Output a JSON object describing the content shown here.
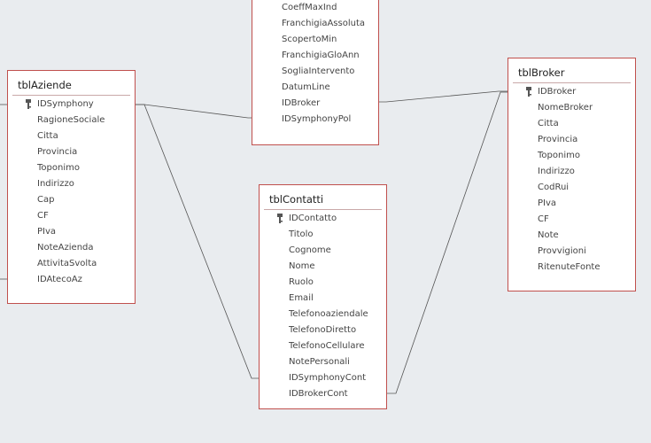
{
  "colors": {
    "canvas": "#e9ecef",
    "table_border": "#c0504d",
    "relation_line": "#555555",
    "key_icon": "#555555"
  },
  "tables": {
    "polizze": {
      "fields": [
        {
          "name": "CoeffMaxInd"
        },
        {
          "name": "FranchigiaAssoluta"
        },
        {
          "name": "ScopertoMin"
        },
        {
          "name": "FranchigiaGloAnn"
        },
        {
          "name": "SogliaIntervento"
        },
        {
          "name": "DatumLine"
        },
        {
          "name": "IDBroker"
        },
        {
          "name": "IDSymphonyPol"
        }
      ]
    },
    "aziende": {
      "title": "tblAziende",
      "fields": [
        {
          "name": "IDSymphony",
          "key_icon": "primary-key-icon"
        },
        {
          "name": "RagioneSociale"
        },
        {
          "name": "Citta"
        },
        {
          "name": "Provincia"
        },
        {
          "name": "Toponimo"
        },
        {
          "name": "Indirizzo"
        },
        {
          "name": "Cap"
        },
        {
          "name": "CF"
        },
        {
          "name": "PIva"
        },
        {
          "name": "NoteAzienda"
        },
        {
          "name": "AttivitaSvolta"
        },
        {
          "name": "IDAtecoAz"
        }
      ]
    },
    "contatti": {
      "title": "tblContatti",
      "fields": [
        {
          "name": "IDContatto",
          "key_icon": "primary-key-icon"
        },
        {
          "name": "Titolo"
        },
        {
          "name": "Cognome"
        },
        {
          "name": "Nome"
        },
        {
          "name": "Ruolo"
        },
        {
          "name": "Email"
        },
        {
          "name": "Telefonoaziendale"
        },
        {
          "name": "TelefonoDiretto"
        },
        {
          "name": "TelefonoCellulare"
        },
        {
          "name": "NotePersonali"
        },
        {
          "name": "IDSymphonyCont"
        },
        {
          "name": "IDBrokerCont"
        }
      ]
    },
    "broker": {
      "title": "tblBroker",
      "fields": [
        {
          "name": "IDBroker",
          "key_icon": "primary-key-icon"
        },
        {
          "name": "NomeBroker"
        },
        {
          "name": "Citta"
        },
        {
          "name": "Provincia"
        },
        {
          "name": "Toponimo"
        },
        {
          "name": "Indirizzo"
        },
        {
          "name": "CodRui"
        },
        {
          "name": "PIva"
        },
        {
          "name": "CF"
        },
        {
          "name": "Note"
        },
        {
          "name": "Provvigioni"
        },
        {
          "name": "RitenuteFonte"
        }
      ]
    }
  }
}
